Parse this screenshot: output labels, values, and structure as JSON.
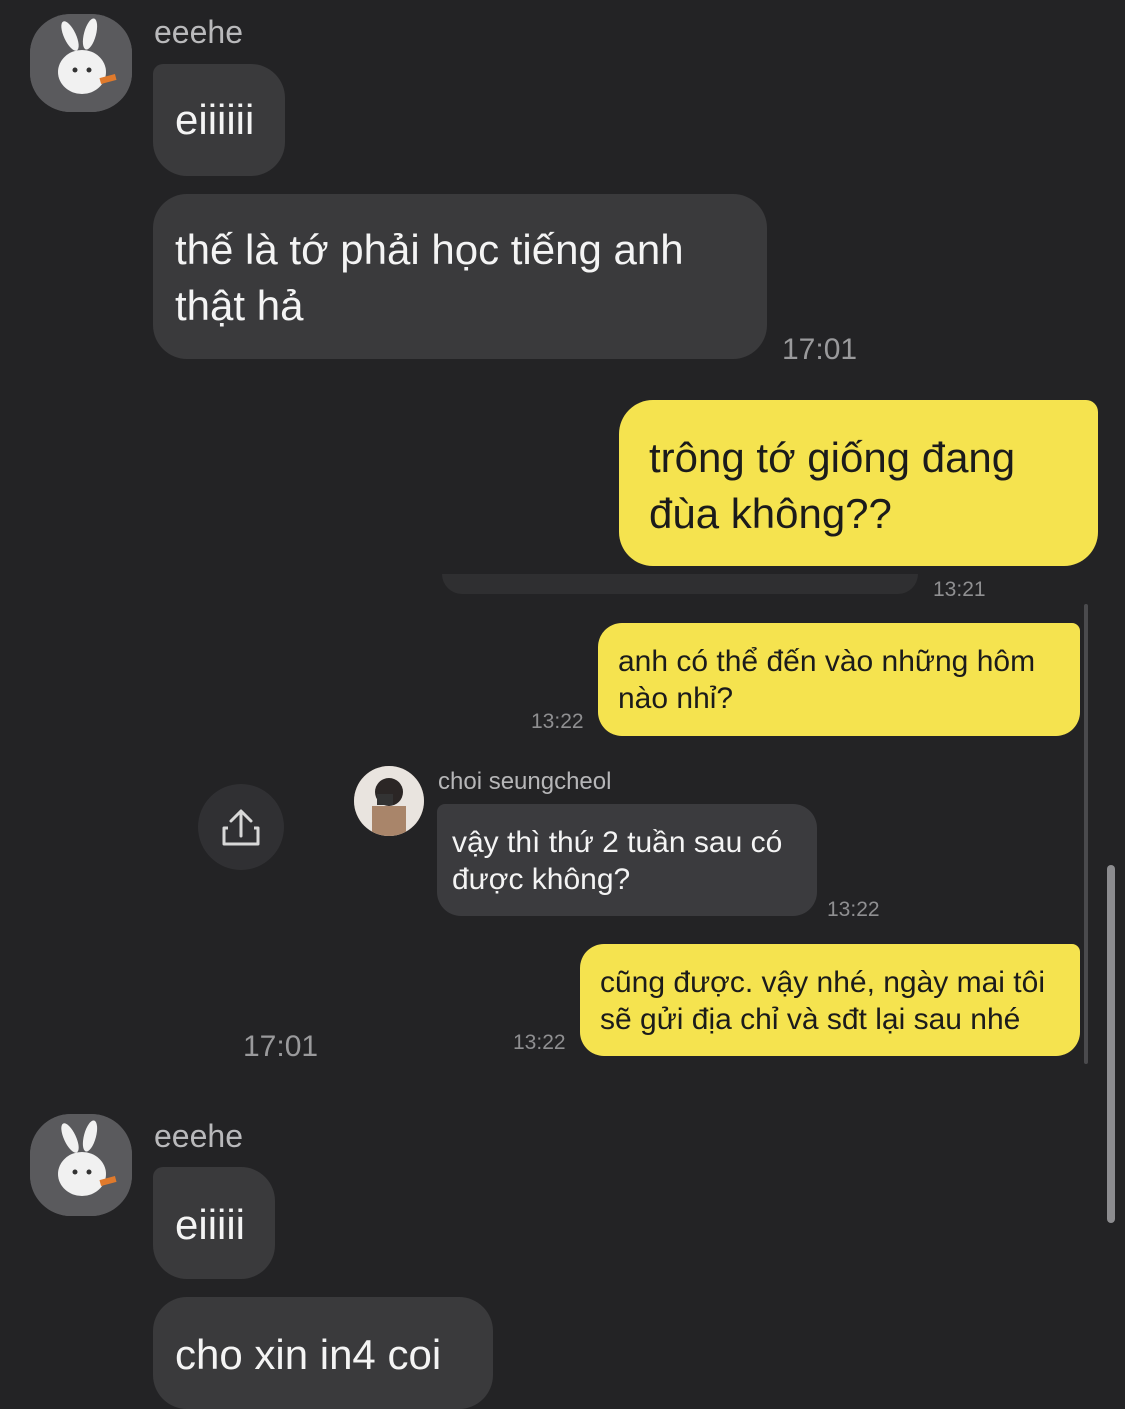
{
  "chat": {
    "sender_name": "eeehe",
    "messages_top": [
      {
        "text": "eiiiiii"
      },
      {
        "text_line1": "thế là tớ phải học tiếng anh",
        "text_line2": "thật hả",
        "time": "17:01"
      }
    ],
    "outgoing": {
      "line1": "trông tớ giống đang",
      "line2": "đùa không??"
    },
    "shared_time": "17:01",
    "messages_bottom": [
      {
        "text": "eiiiii"
      },
      {
        "text": "cho xin in4 coi"
      }
    ]
  },
  "screenshot": {
    "top_time": "13:21",
    "msg1": {
      "line1": "anh có thể đến vào những hôm",
      "line2": "nào nhỉ?",
      "time": "13:22"
    },
    "contact_name": "choi seungcheol",
    "msg2": {
      "line1": "vậy thì thứ 2 tuần sau có",
      "line2": "được không?",
      "time": "13:22"
    },
    "msg3": {
      "line1": "cũng được. vậy nhé, ngày mai tôi",
      "line2": "sẽ gửi địa chỉ và sđt lại sau nhé",
      "time": "13:22"
    }
  },
  "colors": {
    "background": "#232325",
    "incoming": "#3a3a3c",
    "outgoing": "#f5e34f"
  },
  "icons": {
    "share": "share-icon",
    "avatar_main": "rabbit-avatar",
    "avatar_contact": "person-camera-avatar"
  }
}
